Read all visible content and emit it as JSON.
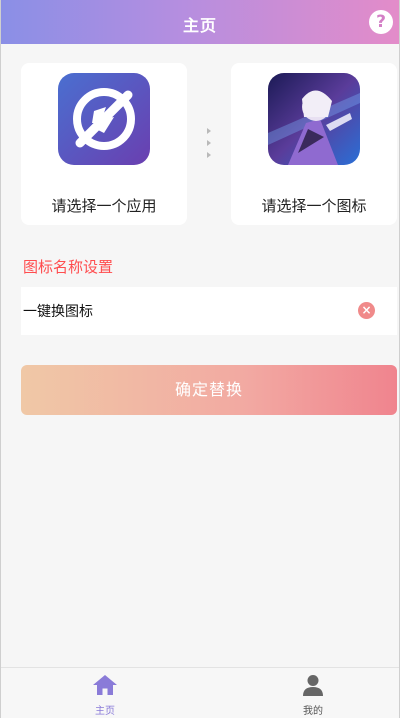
{
  "header": {
    "title": "主页",
    "help_icon": "question-circle-icon",
    "gradient": [
      "#8a8fe6",
      "#e38cc9"
    ]
  },
  "cards": {
    "app": {
      "label": "请选择一个应用",
      "image_icon": "app-logo-icon"
    },
    "icon": {
      "label": "请选择一个图标",
      "image_icon": "anime-character-image"
    }
  },
  "name_setting": {
    "title": "图标名称设置",
    "input_value": "一键换图标",
    "clear_icon": "clear-circle-icon"
  },
  "confirm": {
    "label": "确定替换"
  },
  "tabbar": {
    "items": [
      {
        "label": "主页",
        "icon": "home-icon",
        "active": true
      },
      {
        "label": "我的",
        "icon": "user-icon",
        "active": false
      }
    ]
  },
  "colors": {
    "accent_red": "#ff4d4f",
    "active_tab": "#8a7bd8",
    "button_gradient": [
      "#f0c8a6",
      "#f0848e"
    ]
  }
}
